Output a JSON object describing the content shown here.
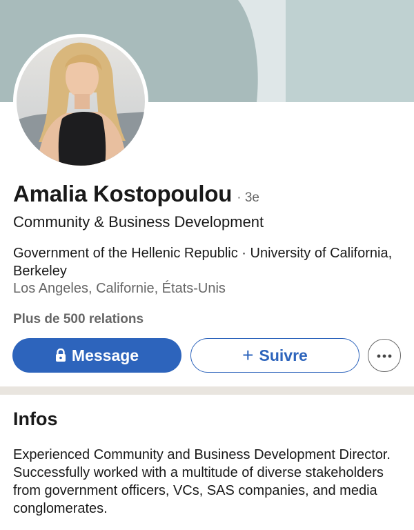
{
  "profile": {
    "name": "Amalia Kostopoulou",
    "degree": "· 3e",
    "headline": "Community & Business Development",
    "education": "Government of the Hellenic Republic · University of California, Berkeley",
    "location": "Los Angeles, Californie, États-Unis",
    "connections": "Plus de 500 relations"
  },
  "actions": {
    "message_label": "Message",
    "follow_label": "Suivre",
    "follow_icon": "plus-icon",
    "message_icon": "lock-icon",
    "more_icon": "ellipsis-icon"
  },
  "about": {
    "title": "Infos",
    "text": "Experienced Community and Business Development Director. Successfully worked with a multitude of diverse stakeholders from government officers, VCs, SAS companies, and media conglomerates."
  },
  "colors": {
    "primary": "#2d64bc",
    "banner_dark": "#a8bbbb",
    "banner_light": "#bfd1d1",
    "divider": "#e9e5df"
  }
}
